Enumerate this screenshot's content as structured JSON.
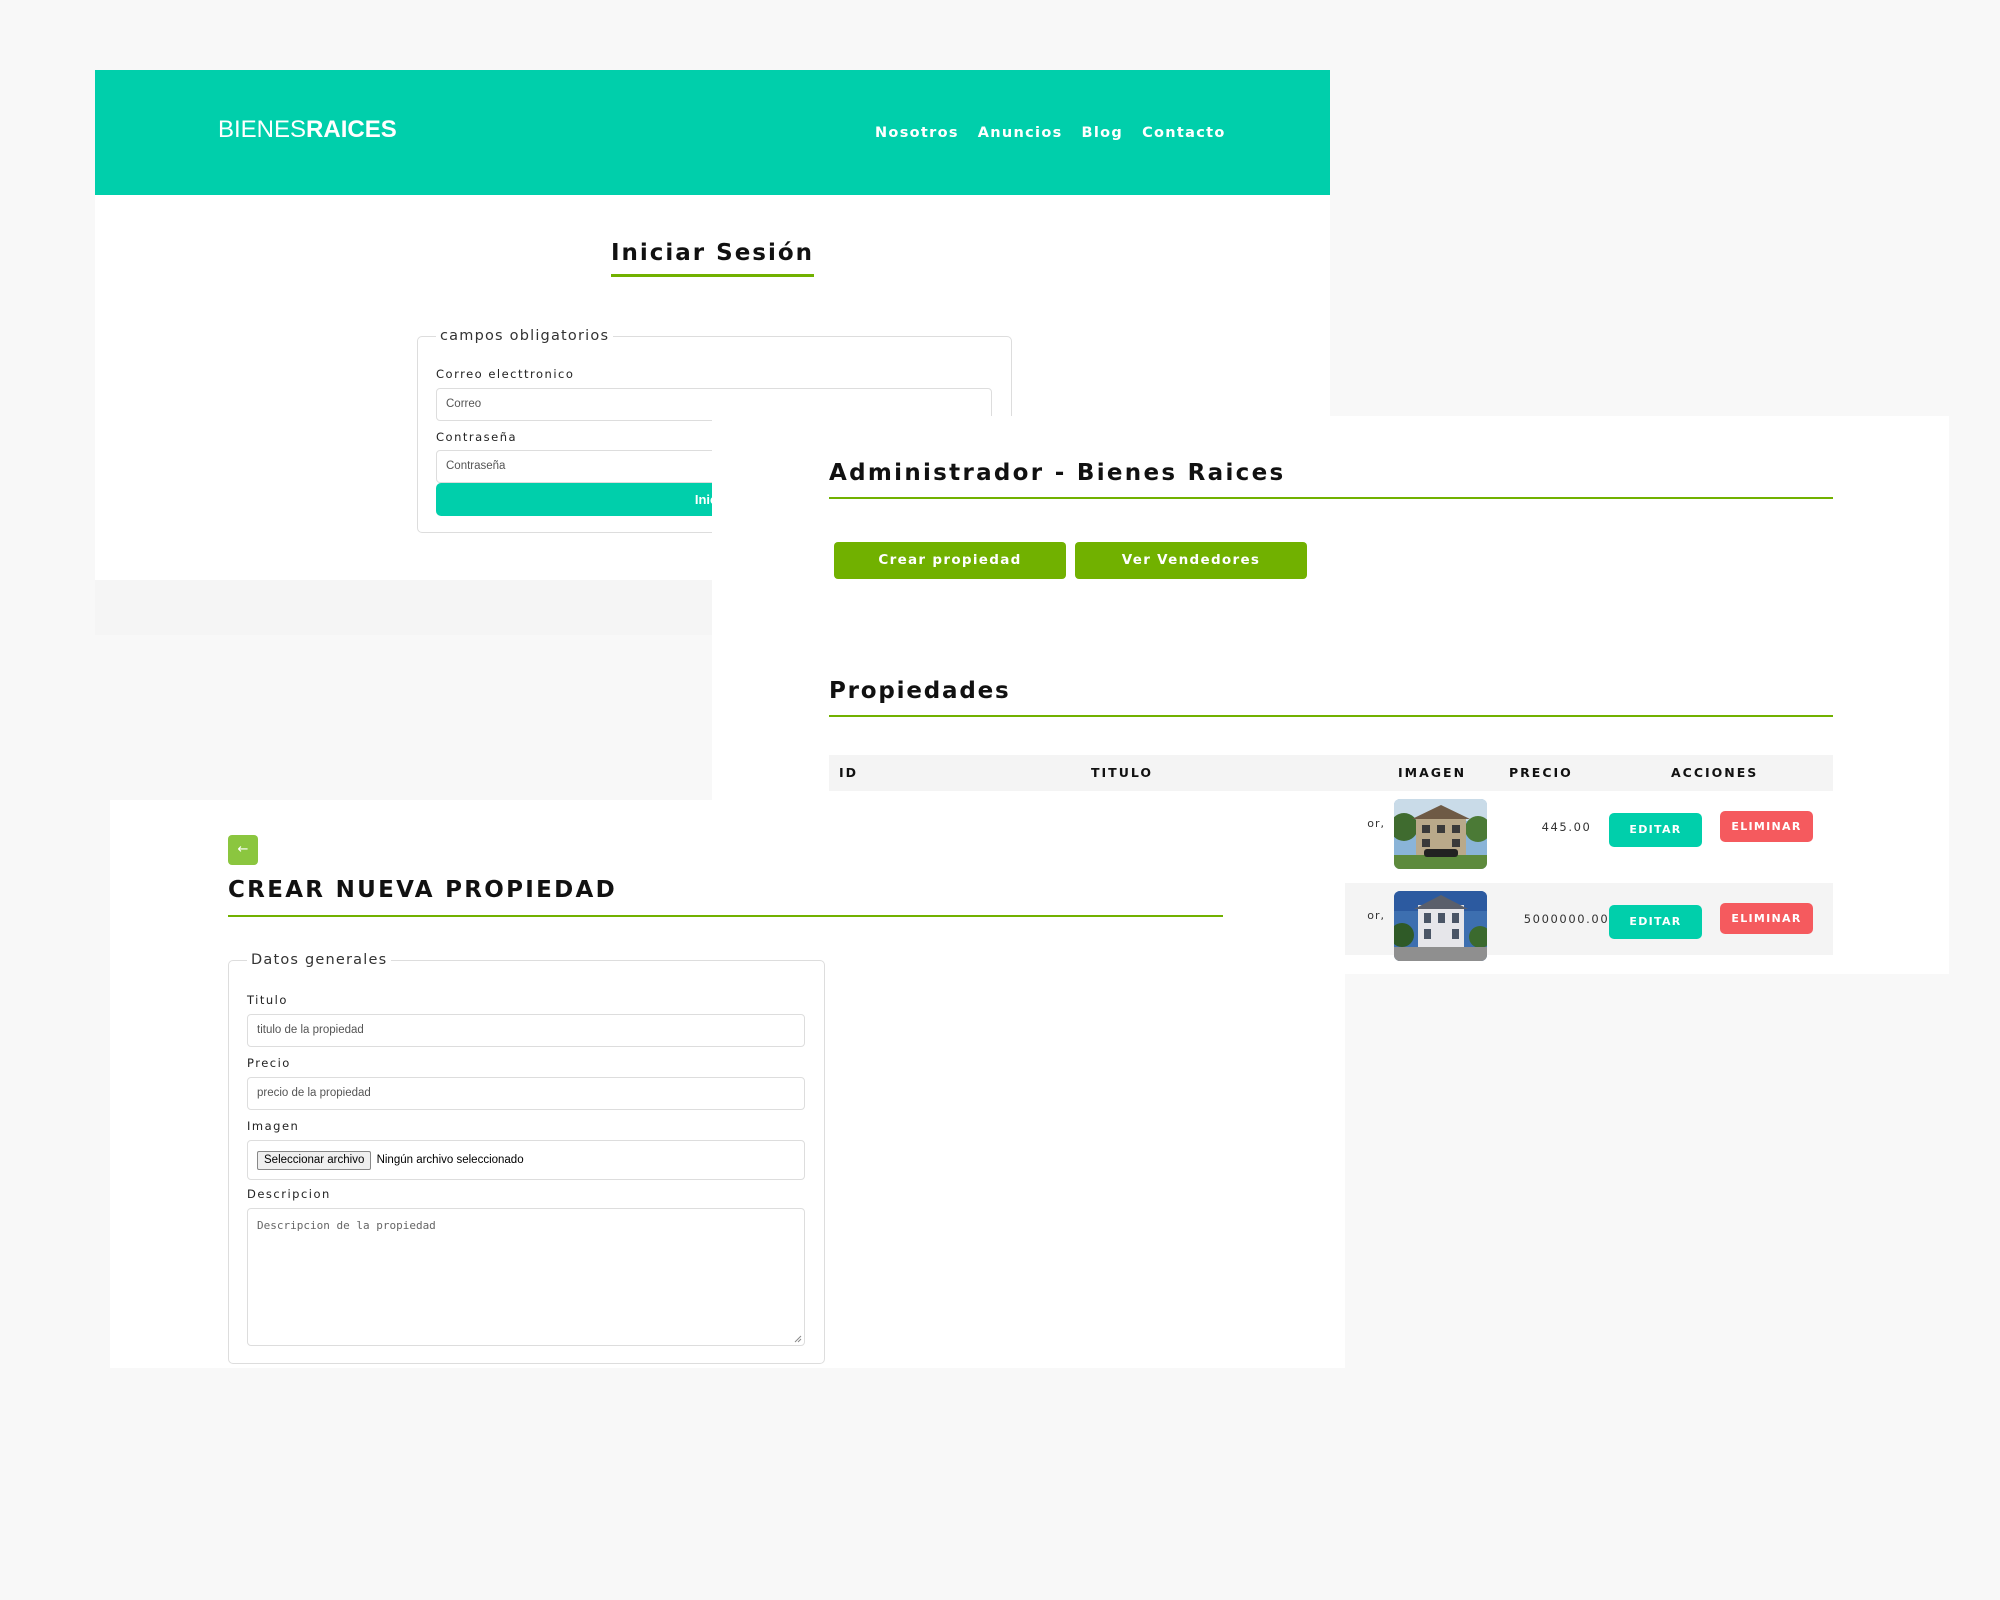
{
  "login": {
    "logo_light": "BIENES",
    "logo_bold": "RAICES",
    "nav": [
      "Nosotros",
      "Anuncios",
      "Blog",
      "Contacto"
    ],
    "title": "Iniciar Sesión",
    "legend": "campos obligatorios",
    "email_label": "Correo electtronico",
    "email_placeholder": "Correo",
    "password_label": "Contraseña",
    "password_placeholder": "Contraseña",
    "submit_label": "Iniciar",
    "accent": "#00cfab"
  },
  "admin": {
    "title": "Administrador - Bienes Raices",
    "create_button": "Crear propiedad",
    "sellers_button": "Ver Vendedores",
    "properties_title": "Propiedades",
    "columns": [
      "ID",
      "TITULO",
      "IMAGEN",
      "PRECIO",
      "ACCIONES"
    ],
    "rows": [
      {
        "title_fragment": "or,",
        "price": "445.00",
        "edit": "EDITAR",
        "delete": "ELIMINAR"
      },
      {
        "title_fragment": "or,",
        "price": "5000000.00",
        "edit": "EDITAR",
        "delete": "ELIMINAR"
      }
    ],
    "accent": "#71b100",
    "danger": "#f55a5e"
  },
  "create": {
    "back_icon": "←",
    "title": "CREAR NUEVA PROPIEDAD",
    "legend": "Datos generales",
    "titulo_label": "Titulo",
    "titulo_placeholder": "titulo de la propiedad",
    "precio_label": "Precio",
    "precio_placeholder": "precio de la propiedad",
    "imagen_label": "Imagen",
    "file_button": "Seleccionar archivo",
    "file_status": "Ningún archivo seleccionado",
    "descripcion_label": "Descripcion",
    "descripcion_placeholder": "Descripcion de la propiedad"
  }
}
